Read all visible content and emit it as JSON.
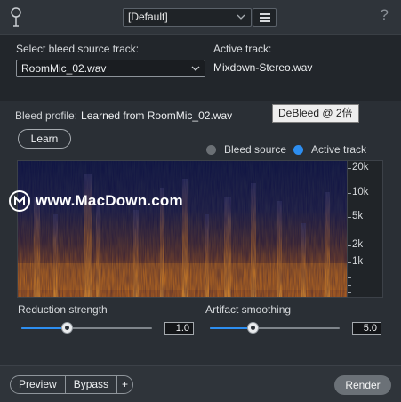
{
  "header": {
    "preset_value": "[Default]",
    "help_label": "?"
  },
  "source": {
    "select_label": "Select bleed source track:",
    "selected_track": "RoomMic_02.wav",
    "active_label": "Active track:",
    "active_value": "Mixdown-Stereo.wav"
  },
  "profile": {
    "label": "Bleed profile:",
    "value": "Learned from RoomMic_02.wav"
  },
  "tooltip": {
    "text": "DeBleed @ 2倍"
  },
  "learn_label": "Learn",
  "legend": {
    "bleed_label": "Bleed source",
    "active_label": "Active track",
    "bleed_color": "#6b7075",
    "active_color": "#2d8ef0"
  },
  "spectrogram": {
    "freq_ticks": [
      "20k",
      "10k",
      "5k",
      "2k",
      "1k"
    ]
  },
  "watermark": {
    "text": "www.MacDown.com"
  },
  "controls": {
    "reduction": {
      "label": "Reduction strength",
      "value": "1.0",
      "fraction": 0.35
    },
    "artifact": {
      "label": "Artifact smoothing",
      "value": "5.0",
      "fraction": 0.33
    }
  },
  "footer": {
    "preview_label": "Preview",
    "bypass_label": "Bypass",
    "plus_label": "+",
    "render_label": "Render"
  },
  "colors": {
    "accent": "#2d8ef0",
    "spectro_low": "#14182e",
    "spectro_high": "#e8891c"
  }
}
